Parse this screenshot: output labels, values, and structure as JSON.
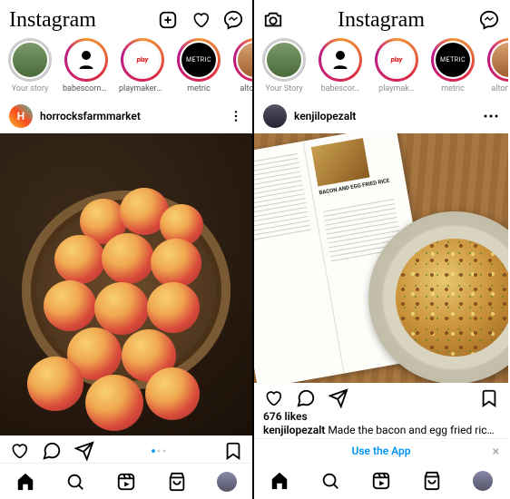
{
  "left": {
    "logo": "Instagram",
    "stories": [
      {
        "label": "Your story",
        "kind": "self"
      },
      {
        "label": "babescorne…",
        "kind": "babes"
      },
      {
        "label": "playmakers...",
        "kind": "playmakers"
      },
      {
        "label": "metric",
        "kind": "metric"
      },
      {
        "label": "altonbro",
        "kind": "alton"
      }
    ],
    "post": {
      "username": "horrocksfarmmarket",
      "avatar_letter": "H"
    }
  },
  "right": {
    "logo": "Instagram",
    "stories": [
      {
        "label": "Your Story",
        "kind": "self"
      },
      {
        "label": "babescor…",
        "kind": "babes"
      },
      {
        "label": "playmak…",
        "kind": "playmakers"
      },
      {
        "label": "metric",
        "kind": "metric"
      },
      {
        "label": "altonbro…",
        "kind": "alton"
      }
    ],
    "post": {
      "username": "kenjilopezalt",
      "likes": "676 likes",
      "caption_user": "kenjilopezalt",
      "caption_text": " Made the bacon and egg fried rice from",
      "book_title": "BACON AND EGG FRIED RICE"
    },
    "use_app": "Use the App",
    "close": "×"
  }
}
